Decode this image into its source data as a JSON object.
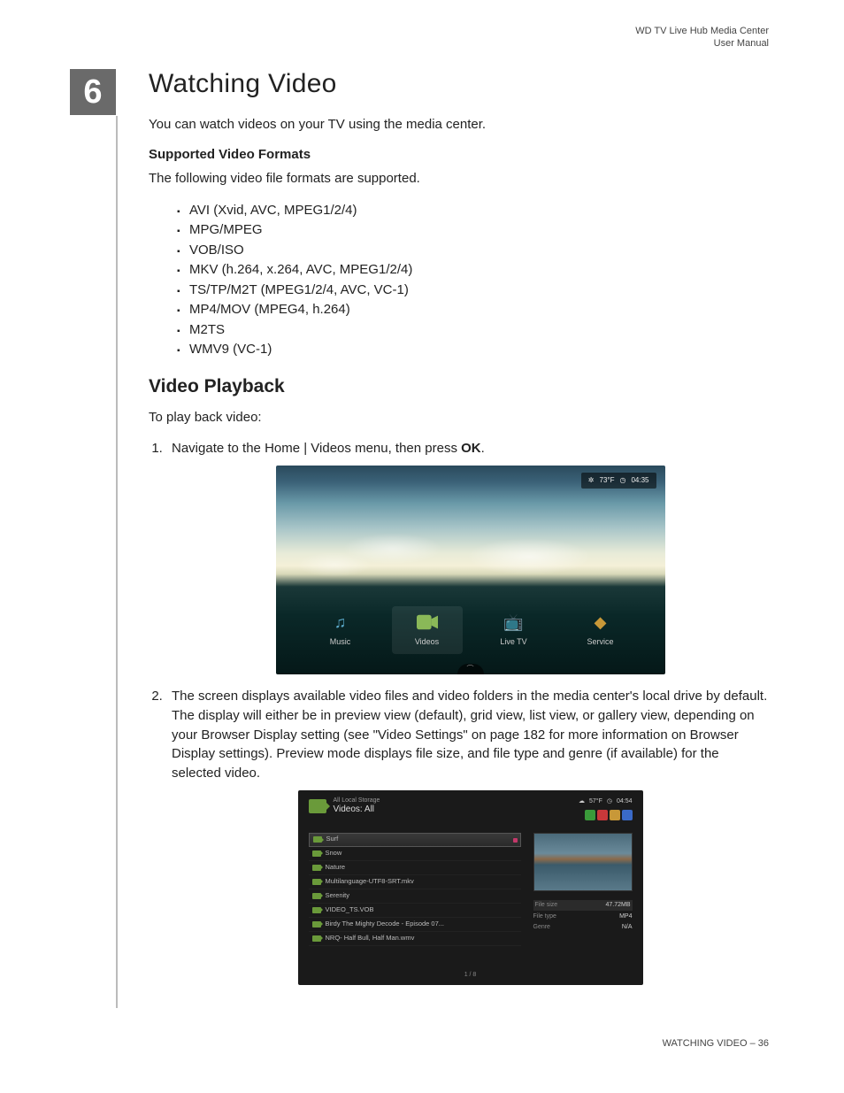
{
  "header": {
    "line1": "WD TV Live Hub Media Center",
    "line2": "User Manual"
  },
  "chapter_number": "6",
  "title": "Watching Video",
  "intro": "You can watch videos on your TV using the media center.",
  "formats_heading": "Supported Video Formats",
  "formats_intro": "The following video file formats are supported.",
  "formats": [
    "AVI (Xvid, AVC, MPEG1/2/4)",
    "MPG/MPEG",
    "VOB/ISO",
    "MKV (h.264, x.264, AVC, MPEG1/2/4)",
    "TS/TP/M2T (MPEG1/2/4, AVC, VC-1)",
    "MP4/MOV (MPEG4, h.264)",
    "M2TS",
    "WMV9 (VC-1)"
  ],
  "playback_heading": "Video Playback",
  "playback_intro": "To play back video:",
  "step1_a": "Navigate to the Home | Videos menu, then press ",
  "step1_b": "OK",
  "step1_c": ".",
  "step2": "The screen displays available video files and video folders in the media center's local drive by default. The display will either be in preview view (default), grid view, list view, or gallery view, depending on your Browser Display setting (see \"Video Settings\" on page 182 for more information on Browser Display settings). Preview mode displays file size, and file type and genre (if available) for the selected video.",
  "shot1": {
    "temp": "73°F",
    "time": "04:35",
    "menu": {
      "music": "Music",
      "videos": "Videos",
      "livetv": "Live TV",
      "services": "Service"
    }
  },
  "shot2": {
    "temp": "57°F",
    "time": "04:54",
    "storage": "All Local Storage",
    "breadcrumb": "Videos: All",
    "items": [
      "Surf",
      "Snow",
      "Nature",
      "Multilanguage-UTF8-SRT.mkv",
      "Serenity",
      "VIDEO_TS.VOB",
      "Birdy The Mighty Decode - Episode 07...",
      "NRQ- Half Bull, Half Man.wmv"
    ],
    "meta": {
      "filesize_l": "File size",
      "filesize_v": "47.72MB",
      "filetype_l": "File type",
      "filetype_v": "MP4",
      "genre_l": "Genre",
      "genre_v": "N/A"
    },
    "pager": "1 / 8"
  },
  "footer": {
    "section": "WATCHING VIDEO",
    "sep": " – ",
    "page": "36"
  }
}
